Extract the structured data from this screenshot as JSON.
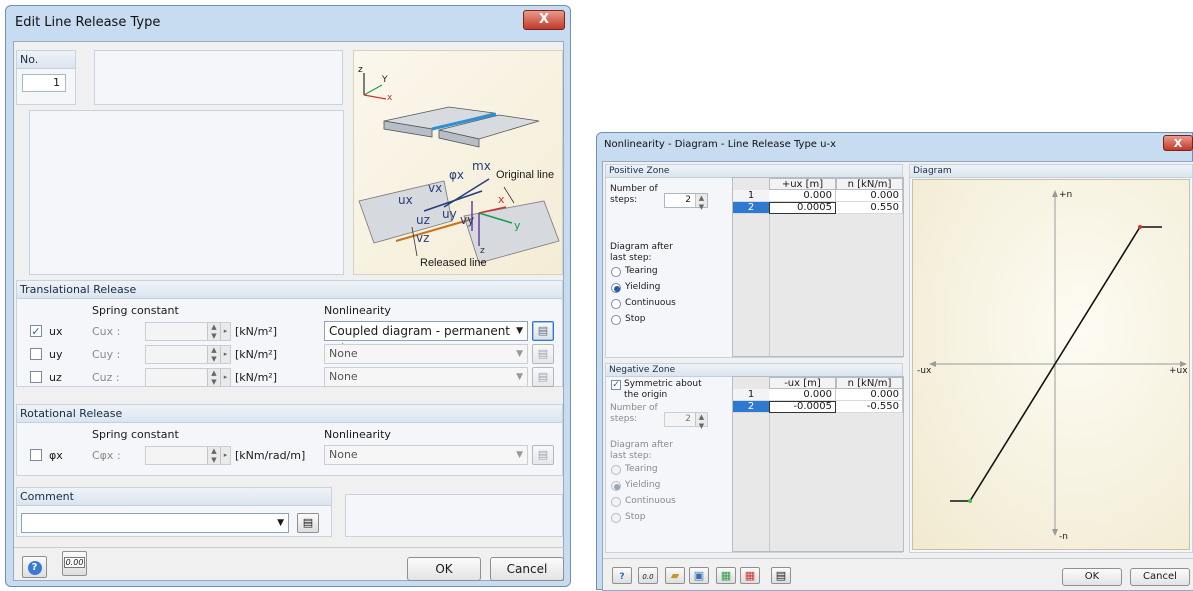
{
  "dialog1": {
    "title": "Edit Line Release Type",
    "close_glyph": "X",
    "no_label": "No.",
    "no_value": "1",
    "illustration": {
      "axis_z": "z",
      "axis_y": "Y",
      "axis_x": "x",
      "label_phi": "φx",
      "label_m": "mx",
      "label_vx": "vx",
      "label_ux": "ux",
      "label_uz": "uz",
      "label_uy": "uy",
      "label_vy": "vy",
      "label_vz": "vz",
      "label_x2": "x",
      "label_y2": "y",
      "label_z2": "z",
      "original_line": "Original line",
      "released_line": "Released line"
    },
    "translational": {
      "header": "Translational Release",
      "spring_header": "Spring constant",
      "nonlin_header": "Nonlinearity",
      "rows": [
        {
          "label": "ux",
          "const": "Cux  :",
          "unit": "[kN/m²]",
          "checked": true,
          "nonlin": "Coupled diagram - permanent releas"
        },
        {
          "label": "uy",
          "const": "Cuy  :",
          "unit": "[kN/m²]",
          "checked": false,
          "nonlin": "None"
        },
        {
          "label": "uz",
          "const": "Cuz  :",
          "unit": "[kN/m²]",
          "checked": false,
          "nonlin": "None"
        }
      ]
    },
    "rotational": {
      "header": "Rotational Release",
      "spring_header": "Spring constant",
      "nonlin_header": "Nonlinearity",
      "rows": [
        {
          "label": "φx",
          "const": "Cφx  :",
          "unit": "[kNm/rad/m]",
          "checked": false,
          "nonlin": "None"
        }
      ]
    },
    "comment": {
      "header": "Comment",
      "value": ""
    },
    "footer": {
      "help_icon": "?",
      "units_icon": "0.00",
      "ok": "OK",
      "cancel": "Cancel"
    }
  },
  "dialog2": {
    "title": "Nonlinearity - Diagram - Line Release Type u-x",
    "close_glyph": "X",
    "positive": {
      "header": "Positive Zone",
      "steps_label": "Number of steps:",
      "steps_value": "2",
      "col1": "+ux [m]",
      "col2": "n [kN/m]",
      "rows": [
        {
          "num": "1",
          "u": "0.000",
          "n": "0.000"
        },
        {
          "num": "2",
          "u": "0.0005",
          "n": "0.550"
        }
      ],
      "after_label": "Diagram after last step:",
      "options": [
        "Tearing",
        "Yielding",
        "Continuous",
        "Stop"
      ],
      "selected": "Yielding"
    },
    "negative": {
      "header": "Negative Zone",
      "symmetric_label": "Symmetric about the origin",
      "symmetric_checked": true,
      "steps_label": "Number of steps:",
      "steps_value": "2",
      "col1": "-ux [m]",
      "col2": "n [kN/m]",
      "rows": [
        {
          "num": "1",
          "u": "0.000",
          "n": "0.000"
        },
        {
          "num": "2",
          "u": "-0.0005",
          "n": "-0.550"
        }
      ],
      "after_label": "Diagram after last step:",
      "options": [
        "Tearing",
        "Yielding",
        "Continuous",
        "Stop"
      ],
      "selected": "Yielding"
    },
    "diagram": {
      "header": "Diagram",
      "pos_n": "+n",
      "neg_n": "-n",
      "neg_u": "-ux",
      "pos_u": "+ux"
    },
    "footer": {
      "ok": "OK",
      "cancel": "Cancel"
    }
  },
  "colors": {
    "accent": "#2e7ad0",
    "frame": "#c7dcf1",
    "selected_row": "#2f7ad1"
  }
}
